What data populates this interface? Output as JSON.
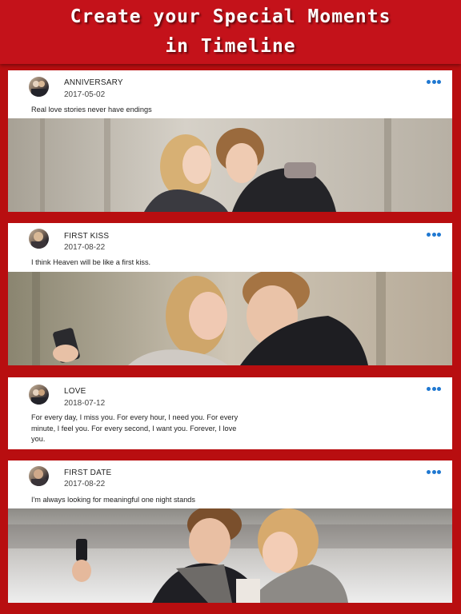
{
  "header": {
    "line1": "Create your Special Moments",
    "line2": "in Timeline"
  },
  "posts": [
    {
      "title": "ANNIVERSARY",
      "date": "2017-05-02",
      "text": "Real love stories never have endings",
      "photo": "couple-forehead-touch-winter"
    },
    {
      "title": "FIRST KISS",
      "date": "2017-08-22",
      "text": "I think Heaven will be like a first kiss.",
      "photo": "couple-kiss-selfie"
    },
    {
      "title": "LOVE",
      "date": "2018-07-12",
      "text": "For every day, I miss you. For every hour, I need you. For every minute, I feel you. For every second, I want you. Forever, I love you.",
      "photo": ""
    },
    {
      "title": "FIRST DATE",
      "date": "2017-08-22",
      "text": "I'm always looking for meaningful one night stands",
      "photo": "couple-selfie-snow"
    }
  ],
  "icons": {
    "more": "more-horizontal-icon",
    "avatar": "user-avatar"
  },
  "colors": {
    "background": "#b80e10",
    "header": "#c4121a",
    "accent": "#1f78d1"
  }
}
